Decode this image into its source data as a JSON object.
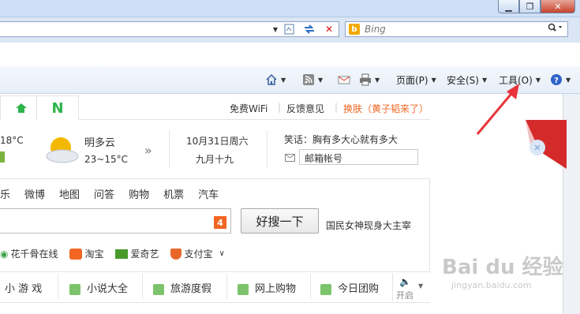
{
  "window": {
    "min_label": "▁",
    "restore_label": "❐",
    "close_label": "✕"
  },
  "search": {
    "placeholder": "Bing"
  },
  "command_bar": {
    "page": "页面(P)",
    "safety": "安全(S)",
    "tools": "工具(O)"
  },
  "page": {
    "top_links": [
      "免费WiFi",
      "反馈意见",
      "换肤（黄子韬来了）"
    ],
    "weather": {
      "temp_left": "18°C",
      "condition": "明多云",
      "range": "23~15°C"
    },
    "date": {
      "gregorian": "10月31日周六",
      "lunar": "九月十九"
    },
    "joke": "笑话：胸有多大心就有多大",
    "mail_placeholder": "邮箱帐号",
    "nav": [
      "乐",
      "微博",
      "地图",
      "问答",
      "购物",
      "机票",
      "汽车"
    ],
    "search_button": "好搜一下",
    "search_badge": "4",
    "hot_search": "国民女神现身大主宰",
    "quick_links": [
      "花千骨在线",
      "淘宝",
      "爱奇艺",
      "支付宝"
    ],
    "categories": [
      "小 游 戏",
      "小说大全",
      "旅游度假",
      "网上购物",
      "今日团购"
    ],
    "sound_label": "开启",
    "watermark": "Bai du 经验",
    "watermark_url": "jingyan.baidu.com"
  },
  "colors": {
    "accent_orange": "#f26522",
    "arrow_red": "#e8333a",
    "weather_yellow": "#f5b800"
  }
}
